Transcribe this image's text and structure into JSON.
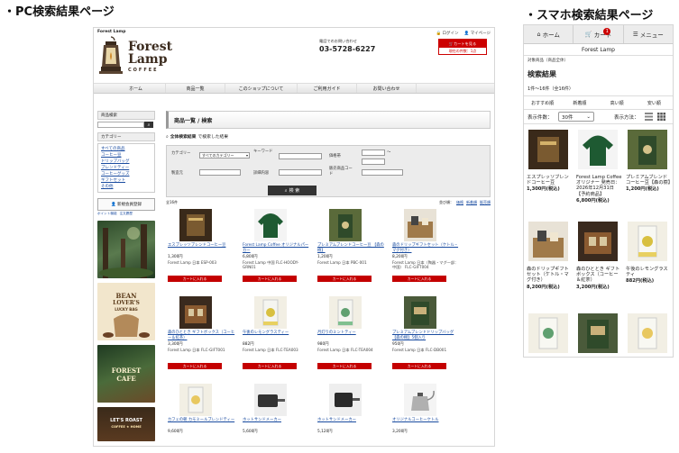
{
  "labels": {
    "pc": "・PC検索結果ページ",
    "sp": "・スマホ検索結果ページ"
  },
  "pc": {
    "header": {
      "shop_small": "Forest Lamp",
      "brand_line1": "Forest",
      "brand_line2": "Lamp",
      "brand_sub": "COFFEE",
      "login": "ログイン",
      "mypage": "マイページ",
      "tel_label": "電話でのお問い合わせ",
      "tel": "03-5728-6227",
      "cart_button": "カートを見る",
      "cart_count": "現在の件数：1点"
    },
    "nav": [
      "ホーム",
      "商品一覧",
      "このショップについて",
      "ご利用ガイド",
      "お問い合わせ"
    ],
    "sidebar": {
      "search_head": "商品検索",
      "category_head": "カテゴリー",
      "categories": [
        "すべての商品",
        "コーヒー豆",
        "ドリップバッグ",
        "ブレンドティー",
        "コーヒーグッズ",
        "ギフトセット",
        "その他"
      ],
      "member_button": "新規会員登録",
      "point_link": "ポイント機能",
      "invoice_link": "注文履歴",
      "banner2_line1": "BEAN",
      "banner2_line2": "LOVER'S",
      "banner2_line3": "LUCKY BAG",
      "banner3_line1": "FOREST",
      "banner3_line2": "CAFE",
      "banner4_line1": "LET'S ROAST",
      "banner4_line2": "COFFEE ★ HOME"
    },
    "main": {
      "heading": "商品一覧 / 検索",
      "result_bold": "全体検索結果",
      "result_rest": "で検索した結果",
      "form": {
        "category_label": "カテゴリー",
        "category_value": "すべてのカテゴリー",
        "keyword_label": "キーワード",
        "price_label": "価格帯",
        "price_to": "〜",
        "stock_label": "製造元",
        "detail_label": "詳細内容",
        "code_label": "販売商品コード",
        "submit": "検 索"
      },
      "item_count": "全16件",
      "sort_label": "並び順：",
      "sort_options": [
        "価格",
        "新着順",
        "販売順"
      ],
      "add_to_cart": "カートに入れる",
      "products": [
        {
          "name": "エスプレッソブレンドコーヒー豆",
          "price": "1,300円",
          "code": "Forest Lamp 日本 ESP-003"
        },
        {
          "name": "Forest Lamp Coffee オリジナルパーカー",
          "price": "6,800円",
          "code": "Forest Lamp 中国 FLC-HOODY-GRN01"
        },
        {
          "name": "プレミアムブレンドコーヒー豆 【森の樹】",
          "price": "1,200円",
          "code": "Forest Lamp 日本 PBC-001"
        },
        {
          "name": "森のドリップギフトセット（ケトル・マグ付き）",
          "price": "8,200円",
          "code": "Forest Lamp 日本（陶器・マグ一部：中国） FLC-GIFT004"
        },
        {
          "name": "森のひととき ギフトボックス（コーヒー＆紅茶）",
          "price": "3,300円",
          "code": "Forest Lamp 日本 FLC-GIFT001"
        },
        {
          "name": "午後のレモングラスティー",
          "price": "882円",
          "code": "Forest Lamp 日本 FLC-TEA003"
        },
        {
          "name": "月灯りのミントティー",
          "price": "980円",
          "code": "Forest Lamp 日本 FLC-TEA004"
        },
        {
          "name": "プレミアムブレンドドリップバッグ【森の樹】5個入り",
          "price": "950円",
          "code": "Forest Lamp 日本 FLC-DB001"
        },
        {
          "name": "カフェの朝 カモミールブレンドティー",
          "price": "9,600円",
          "code": ""
        },
        {
          "name": "ホットサンドメーカー",
          "price": "5,600円",
          "code": ""
        },
        {
          "name": "ホットサンドメーカー",
          "price": "5,120円",
          "code": ""
        },
        {
          "name": "オリジナルコーヒーケトル",
          "price": "3,200円",
          "code": ""
        }
      ]
    }
  },
  "sp": {
    "nav": {
      "home": "ホーム",
      "cart": "カート",
      "cart_badge": "1",
      "menu": "メニュー"
    },
    "shop_name": "Forest Lamp",
    "breadcrumb": "対象商品（商品全体）",
    "heading": "検索結果",
    "count": "1件～16件（全16件）",
    "sort_tabs": [
      "おすすめ順",
      "新着順",
      "高い順",
      "安い順"
    ],
    "per_page_label": "表示件数：",
    "per_page_value": "30件",
    "view_label": "表示方法：",
    "products": [
      {
        "name": "エスプレッソブレンドコーヒー豆",
        "price": "1,300円(税込)"
      },
      {
        "name": "Forest Lamp Coffee オリジナー 発売日：2026年12月31日【予約商品】",
        "price": "6,800円(税込)"
      },
      {
        "name": "プレミアムブレンドコーヒー豆【森の樹】",
        "price": "1,200円(税込)"
      },
      {
        "name": "森のドリップギフトセット（ケトル・マグ付き）",
        "price": "8,200円(税込)"
      },
      {
        "name": "森のひととき ギフトボックス（コーヒー＆紅茶）",
        "price": "3,200円(税込)"
      },
      {
        "name": "午後のレモングラスティ",
        "price": "882円(税込)"
      },
      {
        "name": "",
        "price": ""
      },
      {
        "name": "",
        "price": ""
      },
      {
        "name": "",
        "price": ""
      }
    ]
  },
  "colors": {
    "accent": "#c40000",
    "link": "#1a4ca0",
    "brand": "#3b2b1e"
  }
}
